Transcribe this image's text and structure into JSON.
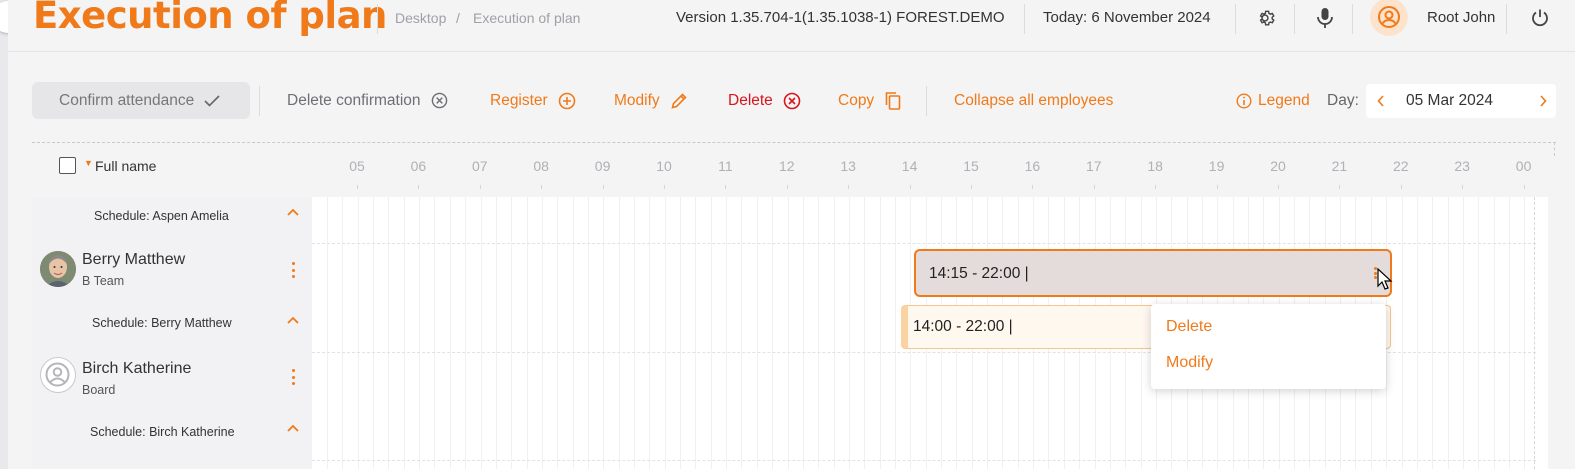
{
  "header": {
    "title": "Execution of plan",
    "breadcrumb": [
      "Desktop",
      "/",
      "Execution of plan"
    ],
    "version": "Version 1.35.704-1(1.35.1038-1) FOREST.DEMO",
    "today": "Today: 6 November 2024",
    "user": "Root John"
  },
  "toolbar": {
    "confirm_attendance": "Confirm attendance",
    "delete_confirmation": "Delete confirmation",
    "register": "Register",
    "modify": "Modify",
    "delete": "Delete",
    "copy": "Copy",
    "collapse_all": "Collapse all employees",
    "legend": "Legend",
    "day_label": "Day:",
    "day_value": "05 Mar 2024"
  },
  "columns": {
    "full_name": "Full name",
    "hours": [
      "05",
      "06",
      "07",
      "08",
      "09",
      "10",
      "11",
      "12",
      "13",
      "14",
      "15",
      "16",
      "17",
      "18",
      "19",
      "20",
      "21",
      "22",
      "23",
      "00"
    ]
  },
  "rows": {
    "schedule_aspen": "Schedule: Aspen Amelia",
    "berry": {
      "name": "Berry Matthew",
      "team": "B Team",
      "schedule": "Schedule: Berry Matthew"
    },
    "birch": {
      "name": "Birch Katherine",
      "team": "Board",
      "schedule": "Schedule: Birch Katherine"
    }
  },
  "shifts": {
    "berry_actual": "14:15 - 22:00 |",
    "berry_schedule": "14:00 - 22:00 |"
  },
  "context_menu": {
    "delete": "Delete",
    "modify": "Modify"
  },
  "colors": {
    "accent": "#f07a1a",
    "danger": "#d8151d"
  }
}
